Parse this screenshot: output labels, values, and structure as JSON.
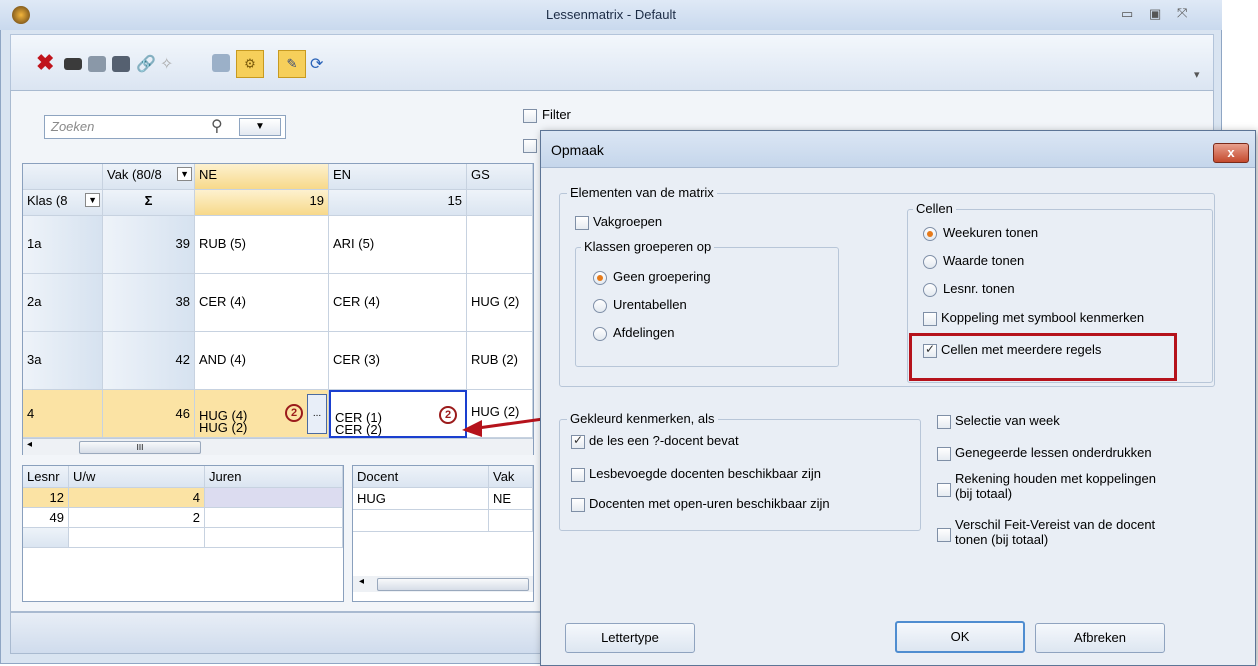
{
  "window": {
    "title": "Lessenmatrix - Default",
    "controls": [
      "minimize-icon",
      "maximize-icon",
      "restore-icon"
    ]
  },
  "toolbar": {
    "icons": [
      "delete-icon",
      "teacher-icon",
      "class-icon",
      "teacher-group-icon",
      "link-icon",
      "magic-icon",
      "search-icon",
      "settings-icon",
      "edit-icon",
      "refresh-icon"
    ]
  },
  "search": {
    "placeholder": "Zoeken"
  },
  "filter": {
    "label": "Filter"
  },
  "matrix": {
    "corner_vak": "Vak (80/8",
    "corner_klas": "Klas (8",
    "sigma": "Σ",
    "columns": [
      "NE",
      "EN",
      "GS"
    ],
    "column_totals": [
      "19",
      "15",
      ""
    ],
    "rows": [
      {
        "klas": "1a",
        "total": "39",
        "cells": [
          "RUB (5)",
          "ARI (5)",
          ""
        ]
      },
      {
        "klas": "2a",
        "total": "38",
        "cells": [
          "CER (4)",
          "CER (4)",
          "HUG (2)"
        ]
      },
      {
        "klas": "3a",
        "total": "42",
        "cells": [
          "AND (4)",
          "CER (3)",
          "RUB (2)"
        ]
      },
      {
        "klas": "4",
        "total": "46",
        "cells": [
          "HUG (4)\nHUG (2)",
          "CER (1)\nCER (2)",
          "HUG (2)"
        ]
      }
    ],
    "badge": "2",
    "ellipsis": "...",
    "scroll_mark": "III"
  },
  "lesson_table": {
    "headers": [
      "Lesnr",
      "U/w",
      "Juren"
    ],
    "rows": [
      [
        "12",
        "4",
        ""
      ],
      [
        "49",
        "2",
        ""
      ]
    ]
  },
  "teacher_table": {
    "headers": [
      "Docent",
      "Vak"
    ],
    "rows": [
      [
        "HUG",
        "NE"
      ]
    ]
  },
  "dialog": {
    "title": "Opmaak",
    "close": "x",
    "elements_group": "Elementen van de matrix",
    "vakgroepen": "Vakgroepen",
    "group_by_label": "Klassen groeperen op",
    "group_by_options": [
      "Geen groepering",
      "Urentabellen",
      "Afdelingen"
    ],
    "group_by_selected": 0,
    "cells_group": "Cellen",
    "cells_options": [
      "Weekuren tonen",
      "Waarde tonen",
      "Lesnr. tonen"
    ],
    "cells_selected": 0,
    "koppeling": "Koppeling met symbool kenmerken",
    "meerdere_regels": "Cellen met meerdere regels",
    "colored_group": "Gekleurd kenmerken, als",
    "colored_options": [
      {
        "label": "de les een ?-docent bevat",
        "checked": true
      },
      {
        "label": "Lesbevoegde docenten beschikbaar zijn",
        "checked": false
      },
      {
        "label": "Docenten met open-uren beschikbaar zijn",
        "checked": false
      }
    ],
    "right_options": [
      {
        "label": "Selectie van week",
        "checked": false
      },
      {
        "label": "Genegeerde lessen onderdrukken",
        "checked": false
      },
      {
        "label": "Rekening houden met koppelingen\n(bij totaal)",
        "checked": false
      },
      {
        "label": "Verschil Feit-Vereist van de docent\ntonen (bij totaal)",
        "checked": false
      }
    ],
    "btn_font": "Lettertype",
    "btn_ok": "OK",
    "btn_cancel": "Afbreken"
  },
  "colors": {
    "accent_red": "#b5121b",
    "highlight": "#fbe3a4"
  }
}
